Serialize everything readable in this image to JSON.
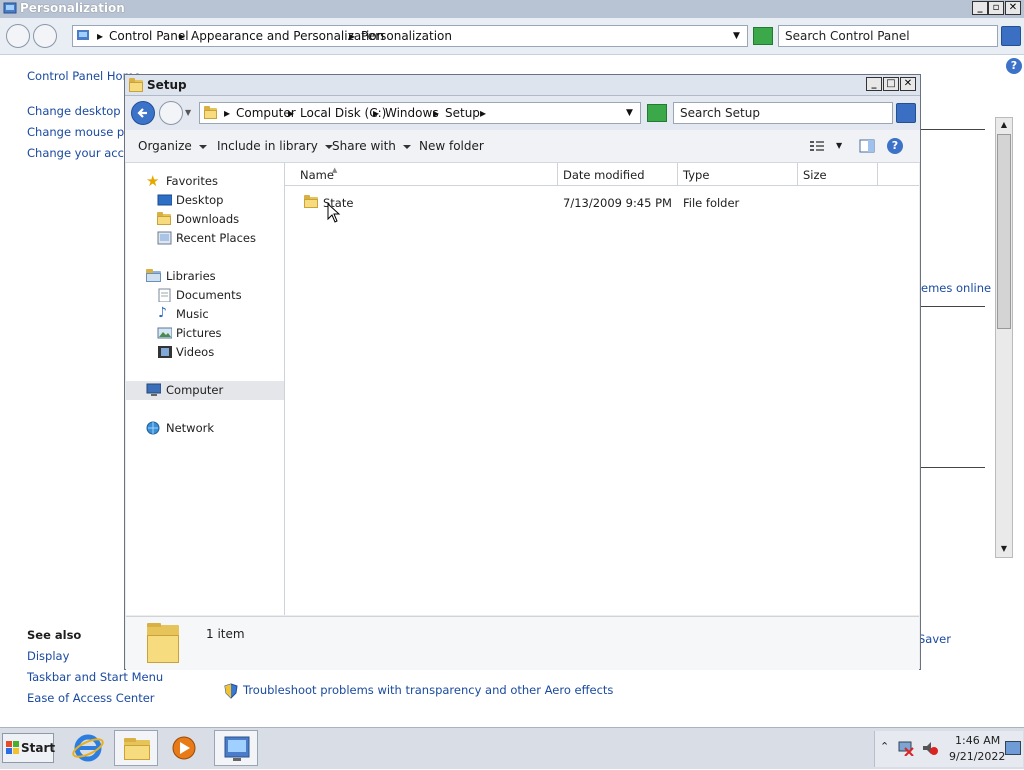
{
  "bg_window": {
    "title": "Personalization",
    "breadcrumb": [
      "Control Panel",
      "Appearance and Personalization",
      "Personalization"
    ],
    "search_placeholder": "Search Control Panel",
    "left_links": [
      "Control Panel Home",
      "Change desktop ico",
      "Change mouse poin",
      "Change your accou"
    ],
    "see_also_title": "See also",
    "see_also_links": [
      "Display",
      "Taskbar and Start Menu",
      "Ease of Access Center"
    ],
    "right_link_fragment": "emes online",
    "saver_fragment": "Saver",
    "troubleshoot": "Troubleshoot problems with transparency and other Aero effects"
  },
  "setup_window": {
    "title": "Setup",
    "breadcrumb": [
      "Computer",
      "Local Disk (C:)",
      "Windows",
      "Setup"
    ],
    "search_placeholder": "Search Setup",
    "toolbar": {
      "organize": "Organize",
      "include": "Include in library",
      "share": "Share with",
      "new_folder": "New folder"
    },
    "nav": {
      "favorites": "Favorites",
      "desktop": "Desktop",
      "downloads": "Downloads",
      "recent": "Recent Places",
      "libraries": "Libraries",
      "documents": "Documents",
      "music": "Music",
      "pictures": "Pictures",
      "videos": "Videos",
      "computer": "Computer",
      "network": "Network"
    },
    "columns": {
      "name": "Name",
      "date": "Date modified",
      "type": "Type",
      "size": "Size"
    },
    "rows": [
      {
        "name": "State",
        "date": "7/13/2009 9:45 PM",
        "type": "File folder",
        "size": ""
      }
    ],
    "status": "1 item"
  },
  "taskbar": {
    "start": "Start",
    "time": "1:46 AM",
    "date": "9/21/2022"
  }
}
